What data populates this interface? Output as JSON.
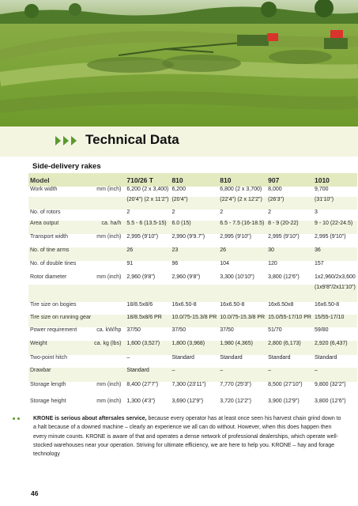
{
  "section": {
    "title": "Technical Data",
    "subtitle": "Side-delivery rakes"
  },
  "table": {
    "header": [
      "Model",
      "",
      "710/26 T",
      "810",
      "810",
      "907",
      "1010"
    ],
    "rows": [
      {
        "label": "Work width",
        "unit": "mm (inch)",
        "v": [
          "6,200 (2 x 3,400)",
          "6,200",
          "6,800 (2 x 3,700)",
          "8,000",
          "9,700"
        ]
      },
      {
        "label": "",
        "unit": "",
        "v": [
          "(20'4\") (2 x 11'2\")",
          "(20'4\")",
          "(22'4\") (2 x 12'2\")",
          "(26'3\")",
          "(31'10\")"
        ]
      },
      {
        "label": "No. of rotors",
        "unit": "",
        "v": [
          "2",
          "2",
          "2",
          "2",
          "3"
        ]
      },
      {
        "label": "Area output",
        "unit": "ca. ha/h",
        "v": [
          "5.5 - 6 (13.5-15)",
          "6.0 (15)",
          "6.5 - 7.5 (16-18.5)",
          "8 - 9 (20-22)",
          "9 - 10 (22-24.5)"
        ]
      },
      {
        "label": "Transport width",
        "unit": "mm (inch)",
        "v": [
          "2,995 (9'10\")",
          "2,990 (9'9.7\")",
          "2,995 (9'10\")",
          "2,995 (9'10\")",
          "2,995 (9'10\")"
        ]
      },
      {
        "label": "No. of tine arms",
        "unit": "",
        "v": [
          "26",
          "23",
          "26",
          "30",
          "36"
        ]
      },
      {
        "label": "No. of double tines",
        "unit": "",
        "v": [
          "91",
          "96",
          "104",
          "120",
          "157"
        ]
      },
      {
        "label": "Rotor diameter",
        "unit": "mm (inch)",
        "v": [
          "2,960 (9'8\")",
          "2,960 (9'8\")",
          "3,300 (10'10\")",
          "3,800 (12'6\")",
          "1x2,960/2x3,600"
        ]
      },
      {
        "label": "",
        "unit": "",
        "v": [
          "",
          "",
          "",
          "",
          "(1x9'8\"/2x11'10\")"
        ]
      },
      {
        "label": "Tire size on bogies",
        "unit": "",
        "v": [
          "18/8.5x8/6",
          "16x6.50-8",
          "16x6.50-8",
          "16x6.50x8",
          "16x6.50-8"
        ]
      },
      {
        "label": "Tire size on running gear",
        "unit": "",
        "v": [
          "18/8.5x8/6 PR",
          "10.0/75-15.3/8 PR",
          "10.0/75-15.3/8 PR",
          "15.0/55-17/10 PR",
          "15/55-17/10"
        ]
      },
      {
        "label": "Power requirement",
        "unit": "ca. kW/hp",
        "v": [
          "37/50",
          "37/50",
          "37/50",
          "51/70",
          "59/80"
        ]
      },
      {
        "label": "Weight",
        "unit": "ca. kg (lbs)",
        "v": [
          "1,600 (3,527)",
          "1,800 (3,968)",
          "1,980 (4,365)",
          "2,800 (6,173)",
          "2,920 (6,437)"
        ]
      },
      {
        "label": "Two-point hitch",
        "unit": "",
        "v": [
          "–",
          "Standard",
          "Standard",
          "Standard",
          "Standard"
        ]
      },
      {
        "label": "Drawbar",
        "unit": "",
        "v": [
          "Standard",
          "–",
          "–",
          "–",
          "–"
        ]
      },
      {
        "label": "Storage length",
        "unit": "mm (inch)",
        "v": [
          "8,400 (27'7\")",
          "7,300 (23'11\")",
          "7,770 (25'3\")",
          "8,500 (27'10\")",
          "9,800 (32'2\")"
        ]
      },
      {
        "label": "Storage height",
        "unit": "mm (inch)",
        "v": [
          "1,300 (4'3\")",
          "3,690 (12'9\")",
          "3,720 (12'2\")",
          "3,900 (12'9\")",
          "3,800 (12'6\")"
        ]
      }
    ]
  },
  "paragraph": {
    "lead": "KRONE is serious about aftersales service,",
    "body": " because every operator has at least once seen his harvest chain grind down to a halt because of a downed machine – clearly an experience we all can do without. However, when this does happen then every minute counts. KRONE is aware of that and operates a dense network of professional dealerships, which operate well-stocked warehouses near your operation. Striving for ultimate efficiency, we are here to help you. KRONE – hay and forage technology"
  },
  "page_number": "46",
  "colors": {
    "accent_green": "#5a9a2e",
    "header_band": "#e3eac0",
    "row_shade": "#f2f5e2",
    "title_band": "#f3f5e1"
  }
}
